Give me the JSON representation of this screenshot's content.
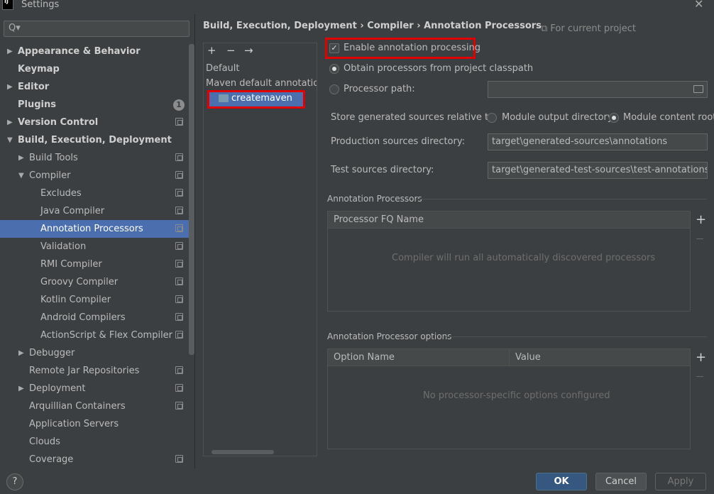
{
  "window": {
    "title": "Settings",
    "app_icon_text": "IJ",
    "close": "✕"
  },
  "search": {
    "placeholder": "Q▾",
    "value": ""
  },
  "nav": [
    {
      "label": "Appearance & Behavior",
      "arrow": "▶",
      "bold": true,
      "scope": false
    },
    {
      "label": "Keymap",
      "arrow": "",
      "bold": true,
      "scope": false
    },
    {
      "label": "Editor",
      "arrow": "▶",
      "bold": true,
      "scope": false
    },
    {
      "label": "Plugins",
      "arrow": "",
      "bold": true,
      "scope": false,
      "badge": "1"
    },
    {
      "label": "Version Control",
      "arrow": "▶",
      "bold": true,
      "scope": true
    },
    {
      "label": "Build, Execution, Deployment",
      "arrow": "▼",
      "bold": true,
      "scope": false
    },
    {
      "label": "Build Tools",
      "arrow": "▶",
      "bold": false,
      "scope": true
    },
    {
      "label": "Compiler",
      "arrow": "▼",
      "bold": false,
      "scope": true
    },
    {
      "label": "Excludes",
      "arrow": "",
      "bold": false,
      "scope": true
    },
    {
      "label": "Java Compiler",
      "arrow": "",
      "bold": false,
      "scope": true
    },
    {
      "label": "Annotation Processors",
      "arrow": "",
      "bold": false,
      "scope": true,
      "selected": true
    },
    {
      "label": "Validation",
      "arrow": "",
      "bold": false,
      "scope": true
    },
    {
      "label": "RMI Compiler",
      "arrow": "",
      "bold": false,
      "scope": true
    },
    {
      "label": "Groovy Compiler",
      "arrow": "",
      "bold": false,
      "scope": true
    },
    {
      "label": "Kotlin Compiler",
      "arrow": "",
      "bold": false,
      "scope": true
    },
    {
      "label": "Android Compilers",
      "arrow": "",
      "bold": false,
      "scope": true
    },
    {
      "label": "ActionScript & Flex Compiler",
      "arrow": "",
      "bold": false,
      "scope": true
    },
    {
      "label": "Debugger",
      "arrow": "▶",
      "bold": false,
      "scope": false
    },
    {
      "label": "Remote Jar Repositories",
      "arrow": "",
      "bold": false,
      "scope": true
    },
    {
      "label": "Deployment",
      "arrow": "▶",
      "bold": false,
      "scope": true
    },
    {
      "label": "Arquillian Containers",
      "arrow": "",
      "bold": false,
      "scope": true
    },
    {
      "label": "Application Servers",
      "arrow": "",
      "bold": false,
      "scope": false
    },
    {
      "label": "Clouds",
      "arrow": "",
      "bold": false,
      "scope": false
    },
    {
      "label": "Coverage",
      "arrow": "",
      "bold": false,
      "scope": true
    }
  ],
  "breadcrumb": {
    "text": "Build, Execution, Deployment  ›  Compiler  ›  Annotation Processors"
  },
  "for_project": "⧉ For current project",
  "module_toolbar": {
    "add": "+",
    "remove": "−",
    "move": "→"
  },
  "modules": {
    "default": "Default",
    "maven": "Maven default annotation processors profile",
    "selected": "createmaven"
  },
  "form": {
    "enable_label": "Enable annotation processing",
    "enable_checked": "✓",
    "obtain_label": "Obtain processors from project classpath",
    "processor_path_label": "Processor path:",
    "processor_path_value": "",
    "store_label": "Store generated sources relative to:",
    "module_output_label": "Module output directory",
    "module_content_label": "Module content root",
    "production_label": "Production sources directory:",
    "production_value": "target\\generated-sources\\annotations",
    "test_label": "Test sources directory:",
    "test_value": "target\\generated-test-sources\\test-annotations"
  },
  "processors_section": {
    "title": "Annotation Processors",
    "column": "Processor FQ Name",
    "empty": "Compiler will run all automatically discovered processors",
    "add": "+"
  },
  "options_section": {
    "title": "Annotation Processor options",
    "col_name": "Option Name",
    "col_value": "Value",
    "empty": "No processor-specific options configured",
    "add": "+"
  },
  "buttons": {
    "help": "?",
    "ok": "OK",
    "cancel": "Cancel",
    "apply": "Apply"
  }
}
